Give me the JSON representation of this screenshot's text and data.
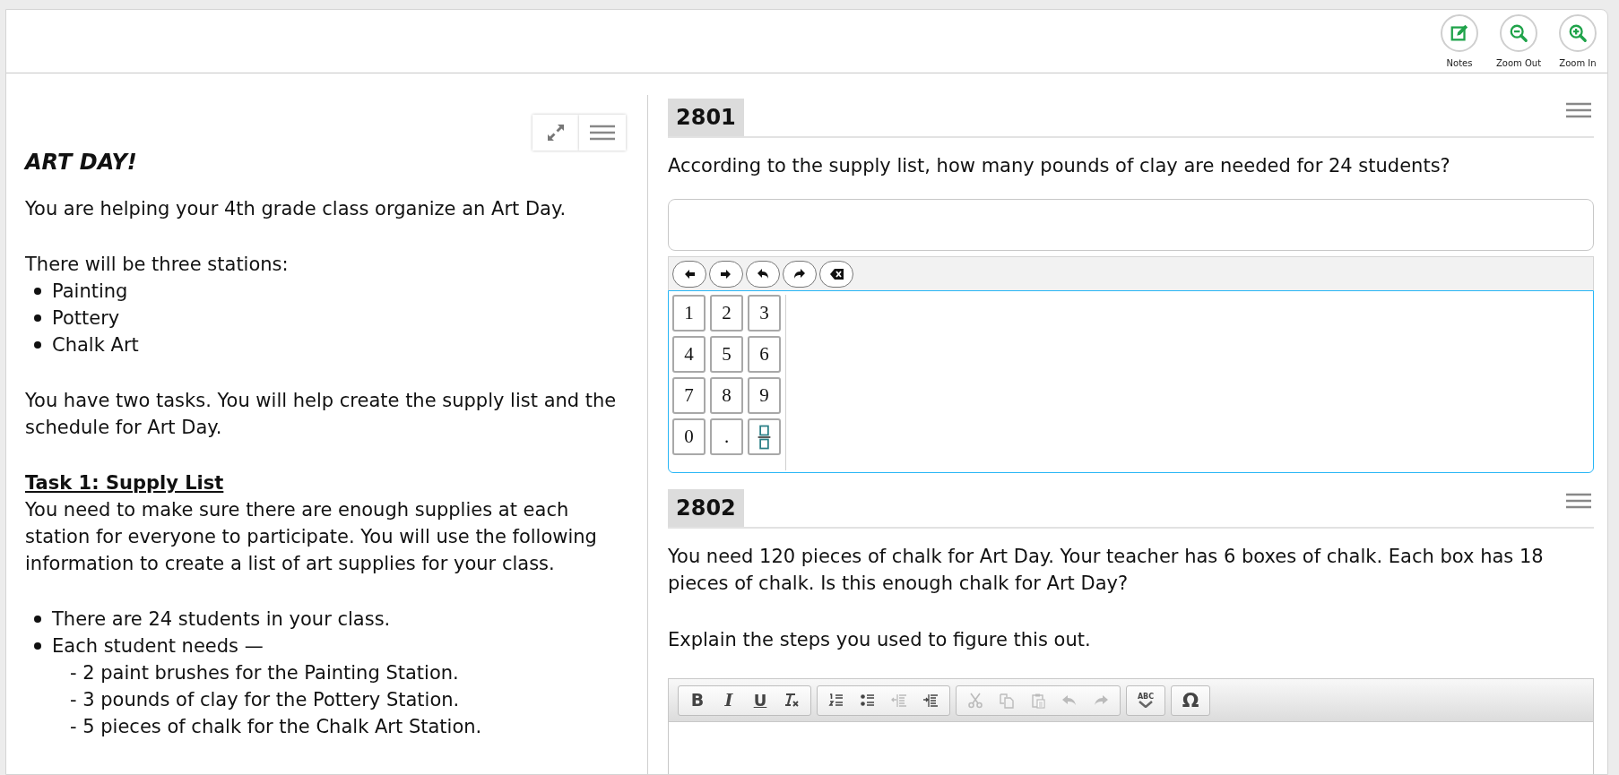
{
  "toolbar": {
    "buttons": [
      {
        "kind": "notes",
        "label": "Notes"
      },
      {
        "kind": "zoom_out",
        "label": "Zoom Out"
      },
      {
        "kind": "zoom_in",
        "label": "Zoom In"
      }
    ]
  },
  "passage": {
    "title": "ART DAY!",
    "sections": [
      [
        {
          "kind": "paragraph",
          "text": "You are helping your 4th grade class organize an Art Day."
        }
      ],
      [
        {
          "kind": "paragraph",
          "text": "There will be three stations:"
        },
        {
          "kind": "bullets",
          "items": [
            {
              "text": "Painting"
            },
            {
              "text": "Pottery"
            },
            {
              "text": "Chalk Art"
            }
          ]
        }
      ],
      [
        {
          "kind": "paragraph",
          "text": "You have two tasks. You will help create the supply list and the schedule for Art Day."
        }
      ],
      [
        {
          "kind": "heading",
          "text": "Task 1: Supply List"
        },
        {
          "kind": "paragraph",
          "text": "You need to make sure there are enough supplies at each station for everyone to participate. You will use the following information to create a list of art supplies for your class."
        }
      ],
      [
        {
          "kind": "bullets",
          "items": [
            {
              "text": "There are 24 students in your class."
            },
            {
              "text": "Each student needs —",
              "children": [
                "- 2 paint brushes for the Painting Station.",
                "- 3 pounds of clay for the Pottery Station.",
                "- 5 pieces of chalk for the Chalk Art Station."
              ]
            }
          ]
        }
      ]
    ]
  },
  "questions": [
    {
      "number": "2801",
      "prompt": [
        "According to the supply list, how many pounds of clay are needed for 24 students?"
      ],
      "answer": {
        "kind": "keypad",
        "edit_tools": [
          {
            "kind": "left"
          },
          {
            "kind": "right"
          },
          {
            "kind": "undo"
          },
          {
            "kind": "redo"
          },
          {
            "kind": "backspace"
          }
        ],
        "keys": [
          {
            "kind": "digit",
            "label": "1"
          },
          {
            "kind": "digit",
            "label": "2"
          },
          {
            "kind": "digit",
            "label": "3"
          },
          {
            "kind": "digit",
            "label": "4"
          },
          {
            "kind": "digit",
            "label": "5"
          },
          {
            "kind": "digit",
            "label": "6"
          },
          {
            "kind": "digit",
            "label": "7"
          },
          {
            "kind": "digit",
            "label": "8"
          },
          {
            "kind": "digit",
            "label": "9"
          },
          {
            "kind": "digit",
            "label": "0"
          },
          {
            "kind": "digit",
            "label": "."
          },
          {
            "kind": "fraction"
          }
        ]
      }
    },
    {
      "number": "2802",
      "prompt": [
        "You need 120 pieces of chalk for Art Day. Your teacher has 6 boxes of chalk. Each box has 18 pieces of chalk. Is this enough chalk for Art Day?",
        "Explain the steps you used to figure this out."
      ],
      "answer": {
        "kind": "editor",
        "groups": [
          [
            {
              "kind": "bold",
              "label": "B",
              "disabled": false
            },
            {
              "kind": "italic",
              "label": "I",
              "disabled": false
            },
            {
              "kind": "underline",
              "label": "U",
              "disabled": false
            },
            {
              "kind": "remove_format",
              "disabled": false
            }
          ],
          [
            {
              "kind": "numbered_list",
              "disabled": false
            },
            {
              "kind": "bulleted_list",
              "disabled": false
            },
            {
              "kind": "outdent",
              "disabled": true
            },
            {
              "kind": "indent",
              "disabled": false
            }
          ],
          [
            {
              "kind": "cut",
              "disabled": true
            },
            {
              "kind": "copy",
              "disabled": true
            },
            {
              "kind": "paste",
              "disabled": true
            },
            {
              "kind": "undo",
              "disabled": true
            },
            {
              "kind": "redo",
              "disabled": true
            }
          ],
          [
            {
              "kind": "spellcheck",
              "label": "ABC",
              "disabled": false
            }
          ],
          [
            {
              "kind": "symbol",
              "label": "Ω",
              "disabled": false
            }
          ]
        ]
      }
    }
  ]
}
